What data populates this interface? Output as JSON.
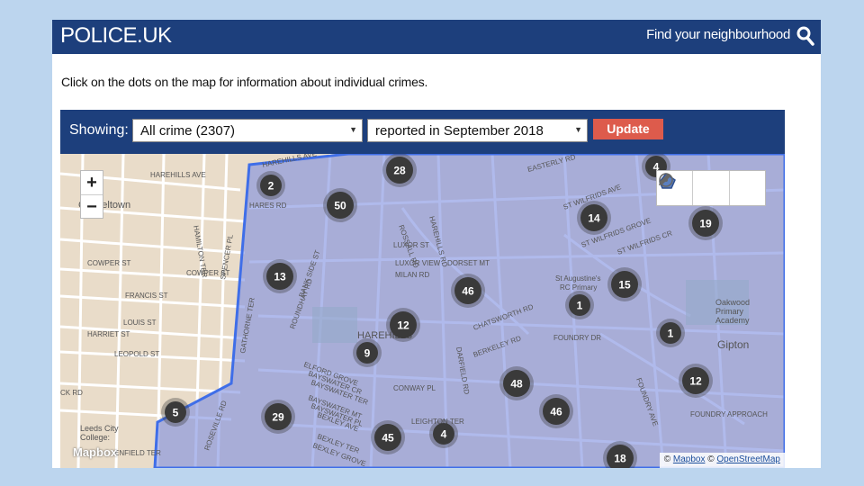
{
  "header": {
    "logo": "POLICE.UK",
    "find_link": "Find your neighbourhood",
    "search_icon": "search-icon"
  },
  "intro_text": "Click on the dots on the map for information about individual crimes.",
  "filters": {
    "showing_label": "Showing:",
    "crime_type": "All crime (2307)",
    "period": "reported in September 2018",
    "update_label": "Update"
  },
  "map": {
    "zoom_in": "+",
    "zoom_out": "−",
    "tools": [
      "polygon-icon",
      "locate-icon",
      "pencil-icon"
    ],
    "attribution": {
      "prefix": "©",
      "mapbox": "Mapbox",
      "sep": "©",
      "osm": "OpenStreetMap"
    },
    "mapbox_logo": "Mapbox",
    "colors": {
      "area": "#7f8fe0",
      "boundary": "#3f6ee8",
      "cluster": "#3a3a3a",
      "base": "#e9dcc9"
    },
    "clusters": [
      {
        "label": "28"
      },
      {
        "label": "4"
      },
      {
        "label": "2"
      },
      {
        "label": "50"
      },
      {
        "label": "14"
      },
      {
        "label": "19"
      },
      {
        "label": "13"
      },
      {
        "label": "46"
      },
      {
        "label": "15"
      },
      {
        "label": "1"
      },
      {
        "label": "12"
      },
      {
        "label": "1"
      },
      {
        "label": "9"
      },
      {
        "label": "48"
      },
      {
        "label": "12"
      },
      {
        "label": "46"
      },
      {
        "label": "5"
      },
      {
        "label": "29"
      },
      {
        "label": "45"
      },
      {
        "label": "4"
      },
      {
        "label": "18"
      }
    ],
    "place_labels": [
      {
        "text": "Chapeltown"
      },
      {
        "text": "Gipton"
      },
      {
        "text": "Oakwood"
      },
      {
        "text": "Primary"
      },
      {
        "text": "Academy"
      },
      {
        "text": "St Augustine's"
      },
      {
        "text": "RC Primary"
      },
      {
        "text": "Leeds City"
      },
      {
        "text": "College:"
      },
      {
        "text": "HAREHILLS AVE"
      },
      {
        "text": "HAREHILLS AVE"
      },
      {
        "text": "HAREHILLS RD"
      },
      {
        "text": "LUXOR ST"
      },
      {
        "text": "LUXOR VIEW"
      },
      {
        "text": "DORSET MT"
      },
      {
        "text": "MILAN RD"
      },
      {
        "text": "COWPER ST"
      },
      {
        "text": "COWPER ST"
      },
      {
        "text": "FRANCIS ST"
      },
      {
        "text": "LOUIS ST"
      },
      {
        "text": "HARRIET ST"
      },
      {
        "text": "LEOPOLD ST"
      },
      {
        "text": "ELFORD GROVE"
      },
      {
        "text": "BAYSWATER CR"
      },
      {
        "text": "BAYSWATER TER"
      },
      {
        "text": "BAYSWATER MT"
      },
      {
        "text": "BAYSWATER PL"
      },
      {
        "text": "BEXLEY AVE"
      },
      {
        "text": "BEXLEY TER"
      },
      {
        "text": "BEXLEY GROVE"
      },
      {
        "text": "CONWAY PL"
      },
      {
        "text": "BERKELEY RD"
      },
      {
        "text": "CHATSWORTH RD"
      },
      {
        "text": "FOUNDRY DR"
      },
      {
        "text": "FOUNDRY APPROACH"
      },
      {
        "text": "EASTERLY RD"
      },
      {
        "text": "ST WILFRIDS AVE"
      },
      {
        "text": "ST WILFRIDS GROVE"
      },
      {
        "text": "ST WILFRIDS CR"
      },
      {
        "text": "ROSSALL RD"
      },
      {
        "text": "ROUNDHAY RD"
      },
      {
        "text": "SPENCER PL"
      },
      {
        "text": "GATHORNE TER"
      },
      {
        "text": "CK RD"
      },
      {
        "text": "HAMILTON TER"
      },
      {
        "text": "HARES RD"
      },
      {
        "text": "ENFIELD TER"
      },
      {
        "text": "ROSEVILLE RD"
      },
      {
        "text": "DARFIELD RD"
      },
      {
        "text": "FOUNDRY AVE"
      },
      {
        "text": "LEIGHTON TER"
      },
      {
        "text": "BANK SIDE ST"
      },
      {
        "text": "HAREHILLS"
      }
    ]
  }
}
